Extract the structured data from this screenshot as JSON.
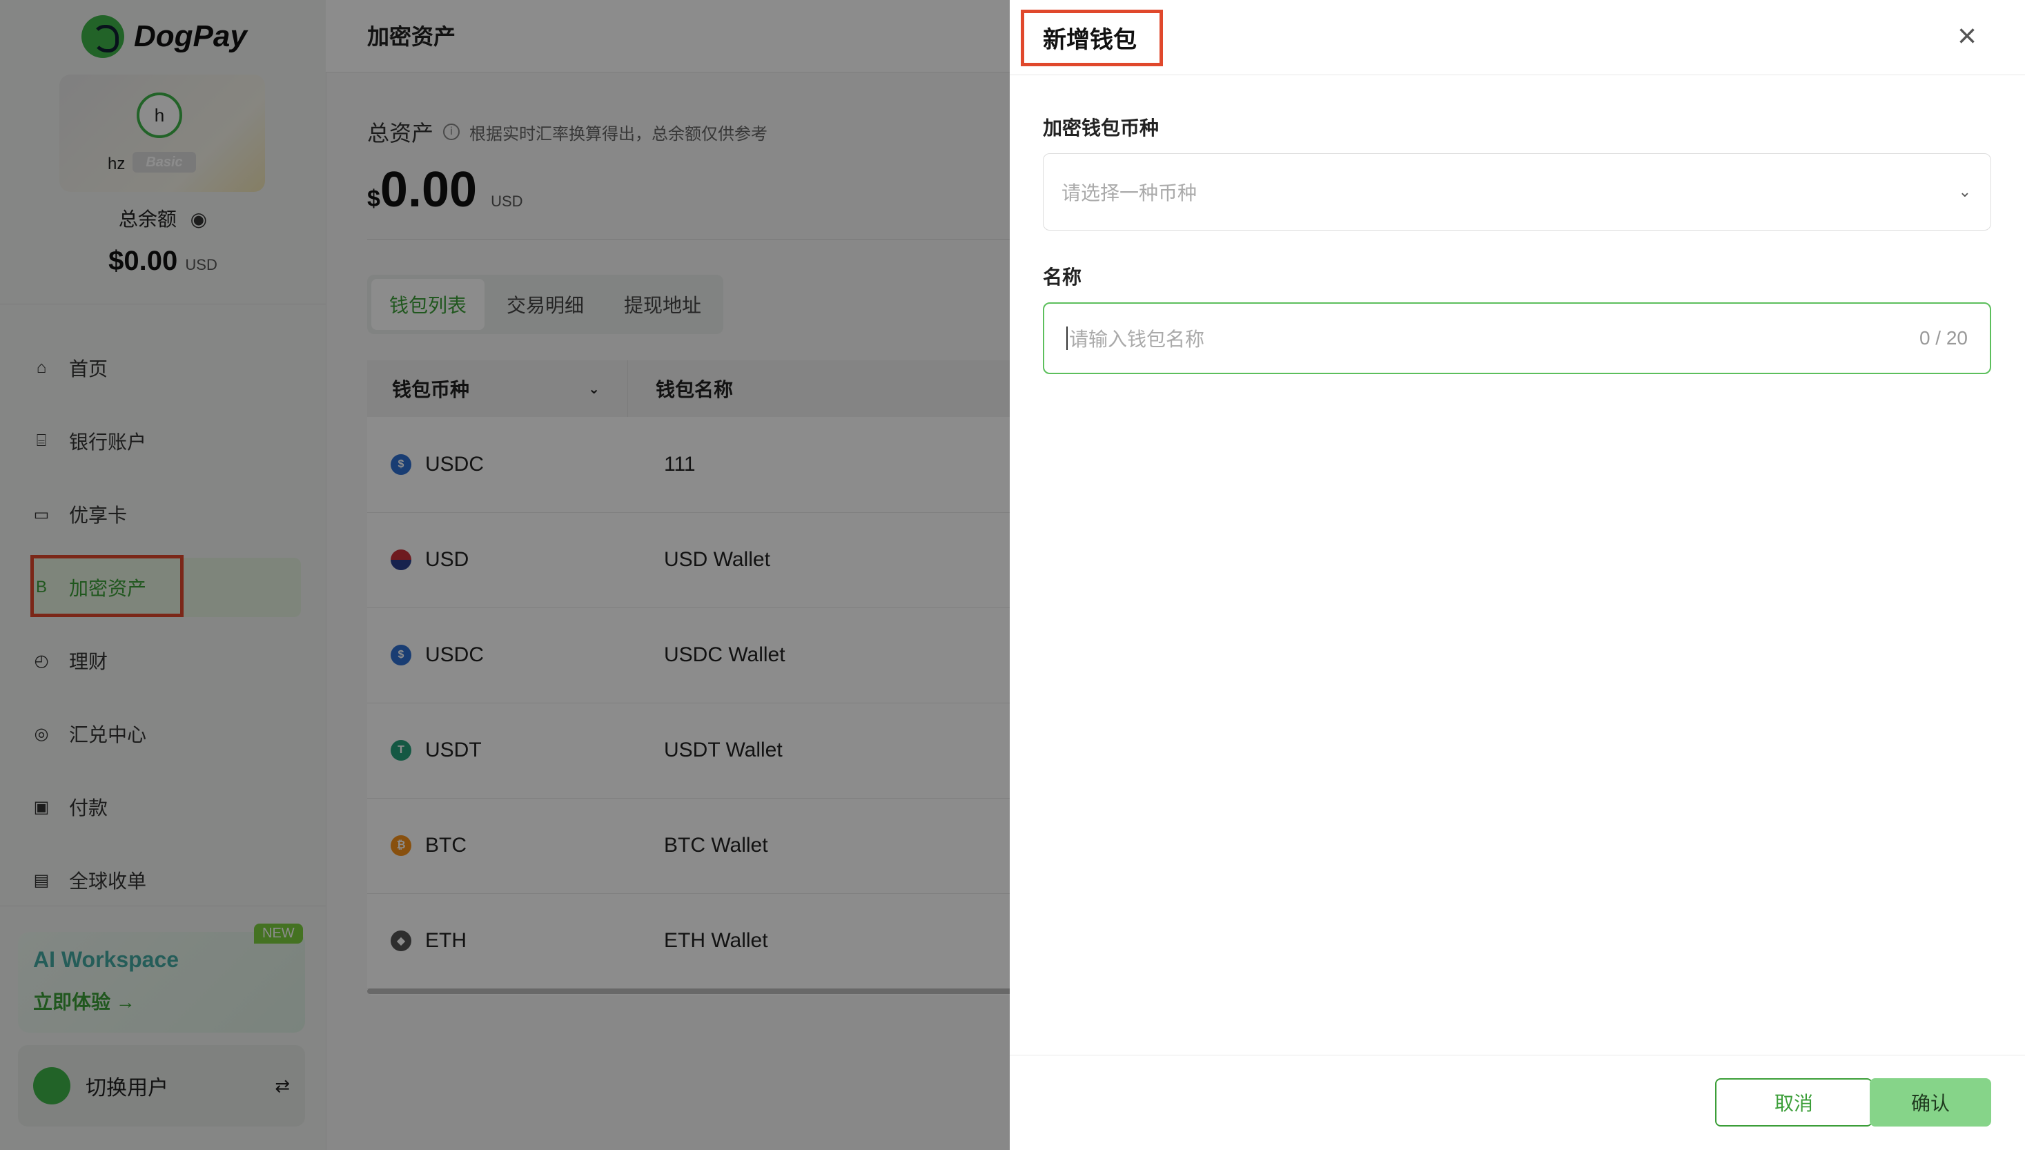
{
  "brand": {
    "name": "DogPay"
  },
  "user": {
    "initial": "h",
    "name": "hz",
    "level": "Basic"
  },
  "balance": {
    "label": "总余额",
    "currency_symbol": "$",
    "amount": "0.00",
    "unit": "USD"
  },
  "nav": [
    {
      "label": "首页",
      "icon": "home-icon",
      "glyph": "⌂"
    },
    {
      "label": "银行账户",
      "icon": "bank-icon",
      "glyph": "⌸"
    },
    {
      "label": "优享卡",
      "icon": "card-icon",
      "glyph": "▭"
    },
    {
      "label": "加密资产",
      "icon": "bitcoin-icon",
      "glyph": "B",
      "active": true
    },
    {
      "label": "理财",
      "icon": "chart-icon",
      "glyph": "◴"
    },
    {
      "label": "汇兑中心",
      "icon": "exchange-icon",
      "glyph": "◎"
    },
    {
      "label": "付款",
      "icon": "wallet-icon",
      "glyph": "▣"
    },
    {
      "label": "全球收单",
      "icon": "receipt-icon",
      "glyph": "▤"
    }
  ],
  "ai_card": {
    "title": "AI Workspace",
    "link": "立即体验 →",
    "badge": "NEW"
  },
  "switch_user": {
    "label": "切换用户",
    "arrows": "⇄"
  },
  "main": {
    "title": "加密资产",
    "asset_label": "总资产",
    "asset_note": "根据实时汇率换算得出，总余额仅供参考",
    "asset_symbol": "$",
    "asset_amount": "0.00",
    "asset_unit": "USD",
    "tabs": [
      "钱包列表",
      "交易明细",
      "提现地址"
    ],
    "table": {
      "headers": [
        "钱包币种",
        "钱包名称"
      ],
      "rows": [
        {
          "coin": "USDC",
          "name": "111",
          "color": "#2f6fd1"
        },
        {
          "coin": "USD",
          "name": "USD Wallet",
          "color": "#c9303a"
        },
        {
          "coin": "USDC",
          "name": "USDC Wallet",
          "color": "#2f6fd1"
        },
        {
          "coin": "USDT",
          "name": "USDT Wallet",
          "color": "#26a17b"
        },
        {
          "coin": "BTC",
          "name": "BTC Wallet",
          "color": "#f7931a"
        },
        {
          "coin": "ETH",
          "name": "ETH Wallet",
          "color": "#555555"
        }
      ]
    }
  },
  "drawer": {
    "title": "新增钱包",
    "close": "×",
    "currency_label": "加密钱包币种",
    "currency_placeholder": "请选择一种币种",
    "name_label": "名称",
    "name_placeholder": "请输入钱包名称",
    "name_counter": "0 / 20",
    "cancel": "取消",
    "confirm": "确认"
  }
}
